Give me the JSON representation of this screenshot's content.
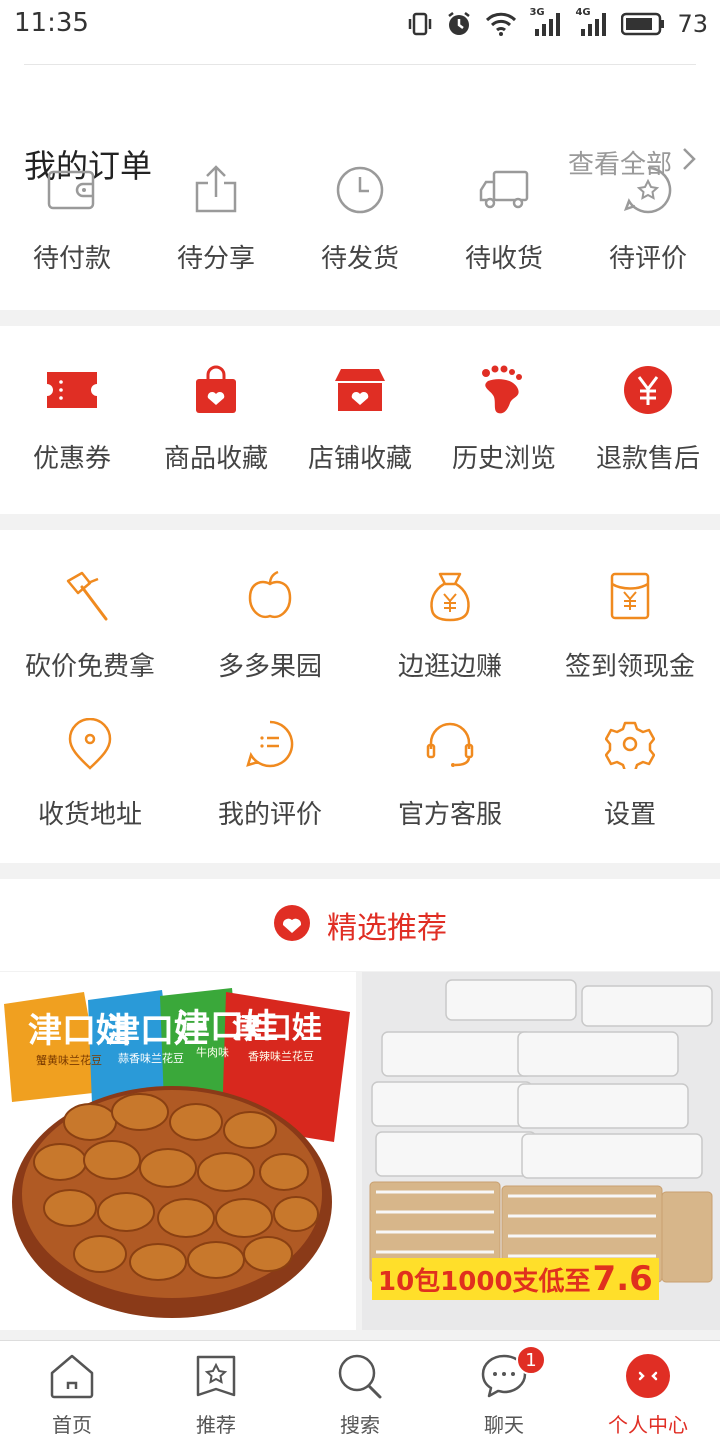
{
  "status_bar": {
    "time": "11:35",
    "network_1": "3G",
    "network_2": "4G",
    "battery": "73"
  },
  "orders": {
    "title": "我的订单",
    "view_all": "查看全部",
    "items": [
      {
        "label": "待付款",
        "icon": "wallet-icon"
      },
      {
        "label": "待分享",
        "icon": "share-icon"
      },
      {
        "label": "待发货",
        "icon": "clock-icon"
      },
      {
        "label": "待收货",
        "icon": "truck-icon"
      },
      {
        "label": "待评价",
        "icon": "review-star-icon"
      }
    ]
  },
  "favorites": {
    "items": [
      {
        "label": "优惠券",
        "icon": "coupon-icon"
      },
      {
        "label": "商品收藏",
        "icon": "bag-heart-icon"
      },
      {
        "label": "店铺收藏",
        "icon": "store-heart-icon"
      },
      {
        "label": "历史浏览",
        "icon": "footprint-icon"
      },
      {
        "label": "退款售后",
        "icon": "yuan-icon"
      }
    ]
  },
  "tools": {
    "row1": [
      {
        "label": "砍价免费拿",
        "icon": "axe-icon"
      },
      {
        "label": "多多果园",
        "icon": "apple-icon"
      },
      {
        "label": "边逛边赚",
        "icon": "money-bag-icon"
      },
      {
        "label": "签到领现金",
        "icon": "red-envelope-icon"
      }
    ],
    "row2": [
      {
        "label": "收货地址",
        "icon": "location-icon"
      },
      {
        "label": "我的评价",
        "icon": "comment-list-icon"
      },
      {
        "label": "官方客服",
        "icon": "headset-icon"
      },
      {
        "label": "设置",
        "icon": "settings-gear-icon"
      }
    ]
  },
  "recommend": {
    "title": "精选推荐"
  },
  "products": {
    "left": {
      "brand_text": "津口娃",
      "flavors": [
        "蟹黄味兰花豆",
        "蒜香味兰花豆",
        "牛肉味",
        "香辣味兰花豆"
      ]
    },
    "right": {
      "promo_text": "10包1000支低至",
      "promo_price": "7.6"
    }
  },
  "bottom_nav": {
    "items": [
      {
        "label": "首页",
        "icon": "home-icon"
      },
      {
        "label": "推荐",
        "icon": "recommend-star-icon"
      },
      {
        "label": "搜索",
        "icon": "search-icon"
      },
      {
        "label": "聊天",
        "icon": "chat-icon",
        "badge": "1"
      },
      {
        "label": "个人中心",
        "icon": "profile-icon",
        "active": true
      }
    ]
  },
  "colors": {
    "brand_red": "#e02e24",
    "tool_orange": "#f08a1f",
    "icon_gray": "#9a9a9a",
    "promo_yellow": "#ffdf2a"
  }
}
